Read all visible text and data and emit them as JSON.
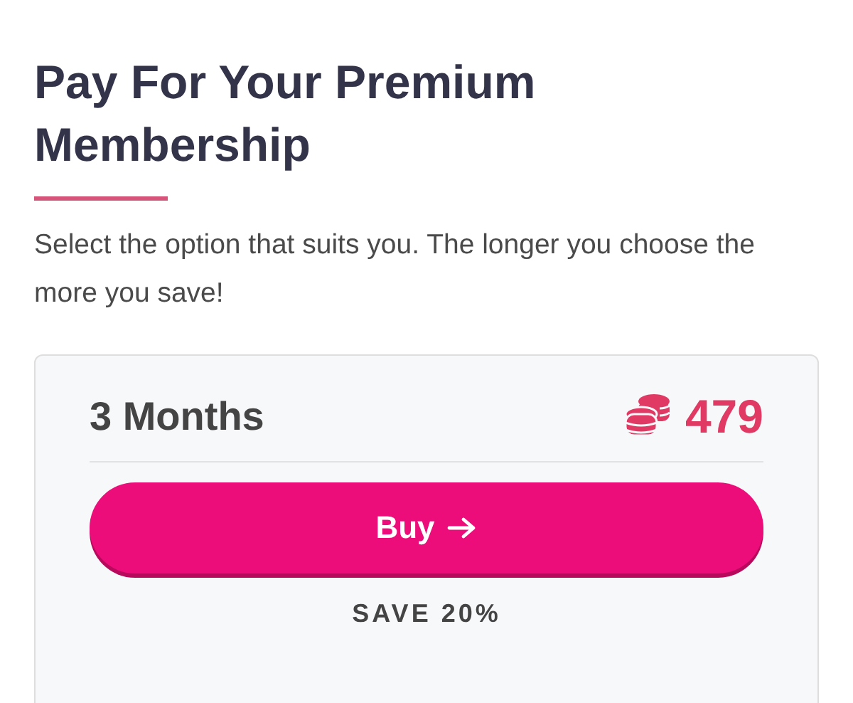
{
  "heading": "Pay For Your Premium Membership",
  "description": "Select the option that suits you. The longer you choose the more you save!",
  "plan": {
    "duration": "3 Months",
    "price": "479",
    "button": "Buy",
    "saving": "SAVE 20%"
  }
}
